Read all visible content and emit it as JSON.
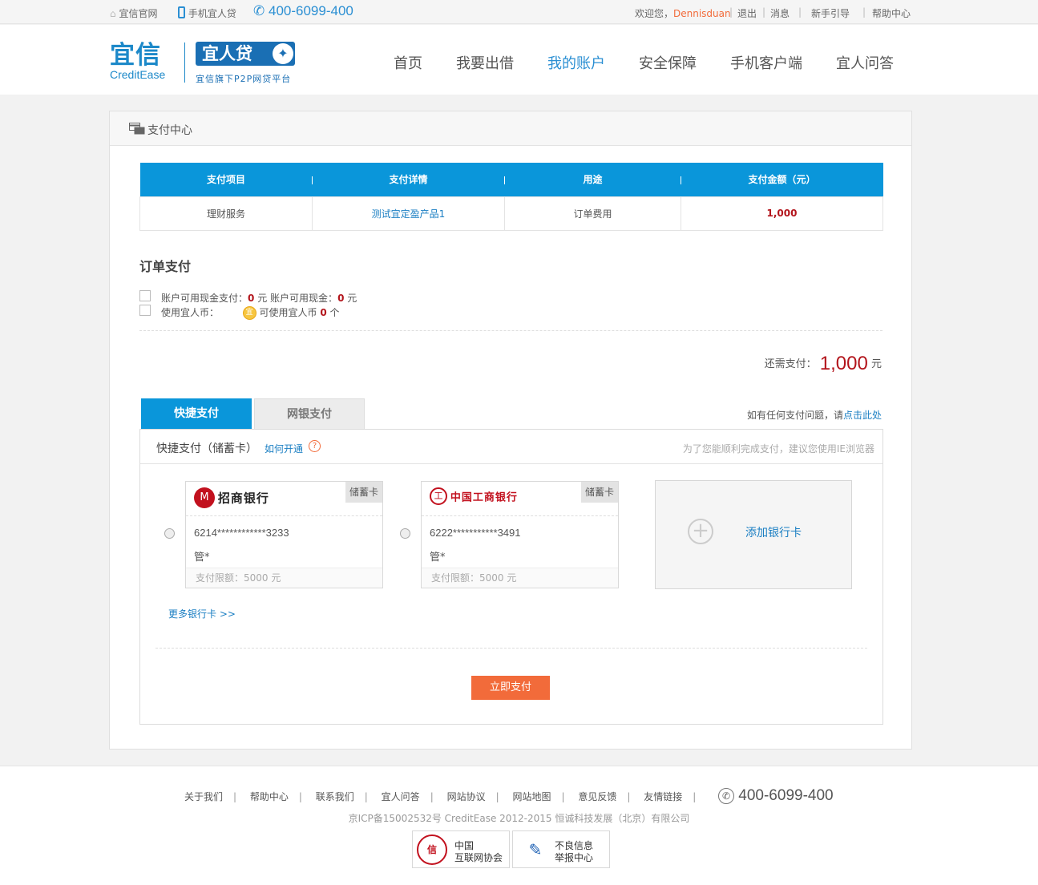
{
  "topbar": {
    "official_site": "宜信官网",
    "mobile_app": "手机宜人贷",
    "phone": "400-6099-400",
    "welcome": "欢迎您，",
    "username": "Dennisduan",
    "logout": "退出",
    "messages": "消息",
    "guide": "新手引导",
    "help": "帮助中心",
    "sep": "|"
  },
  "header": {
    "logo_cn": "宜信",
    "logo_en": "CreditEase",
    "brand": "宜人贷",
    "brand_sub": "宜信旗下P2P网贷平台",
    "nav": [
      "首页",
      "我要出借",
      "我的账户",
      "安全保障",
      "手机客户端",
      "宜人问答"
    ],
    "active_nav": "我的账户"
  },
  "card": {
    "title": "支付中心",
    "table": {
      "headers": [
        "支付项目",
        "支付详情",
        "用途",
        "支付金额（元）"
      ],
      "row": [
        "理财服务",
        "测试宜定盈产品1",
        "订单费用",
        "1,000"
      ]
    },
    "order": {
      "title": "订单支付",
      "cash_label": "账户可用现金支付：",
      "cash_value": "0",
      "unit_yuan": "元",
      "cash_avail_label": "账户可用现金：",
      "cash_avail_value": "0",
      "coin_label": "使用宜人币：",
      "coin_icon_text": "宜",
      "coin_avail_label": "可使用宜人币",
      "coin_avail_value": "0",
      "unit_ge": "个"
    },
    "due": {
      "label": "还需支付：",
      "amount": "1,000",
      "unit": "元"
    },
    "tabs": [
      "快捷支付",
      "网银支付"
    ],
    "help_text": "如有任何支付问题，请",
    "help_link": "点击此处",
    "pane": {
      "title": "快捷支付（储蓄卡）",
      "how": "如何开通",
      "q": "?",
      "tip": "为了您能顺利完成支付，建议您使用IE浏览器",
      "cards": [
        {
          "bank": "招商银行",
          "mark": "M",
          "type": "储蓄卡",
          "number": "6214************3233",
          "holder": "管*",
          "limit": "支付限额：5000 元"
        },
        {
          "bank": "中国工商银行",
          "mark": "工",
          "type": "储蓄卡",
          "number": "6222***********3491",
          "holder": "管*",
          "limit": "支付限额：5000 元"
        }
      ],
      "add_card": "添加银行卡",
      "plus": "+",
      "more": "更多银行卡 >>",
      "pay": "立即支付"
    }
  },
  "footer": {
    "links": [
      "关于我们",
      "帮助中心",
      "联系我们",
      "宜人问答",
      "网站协议",
      "网站地图",
      "意见反馈",
      "友情链接"
    ],
    "sep": "|",
    "phone": "400-6099-400",
    "phone_icon": "✆",
    "copyright": "京ICP备15002532号 CreditEase 2012-2015 恒诚科技发展（北京）有限公司",
    "seal1_mark": "信",
    "seal1": [
      "中国",
      "互联网协会"
    ],
    "seal2_mark": "✎",
    "seal2": [
      "不良信息",
      "举报中心"
    ]
  },
  "colors": {
    "primary": "#0a96da",
    "link": "#1b7fc3",
    "amount": "#b3151c",
    "accent": "#f26b3a"
  },
  "icons": [
    "home-icon",
    "mobile-icon",
    "phone-icon",
    "payment-icon",
    "coin-icon",
    "question-icon",
    "plus-icon"
  ]
}
